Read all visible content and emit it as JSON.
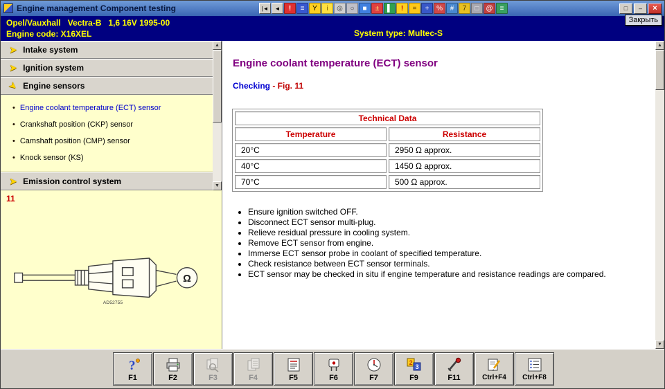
{
  "window": {
    "title": "Engine management Component testing",
    "close_label": "×",
    "close_tooltip": "Закрыть"
  },
  "top_toolbar": {
    "icons": [
      {
        "name": "nav-first-icon",
        "glyph": "|◄"
      },
      {
        "name": "nav-back-icon",
        "glyph": "◄"
      },
      {
        "name": "warning-icon",
        "glyph": "!"
      },
      {
        "name": "wiring-diagram-icon",
        "glyph": "≡"
      },
      {
        "name": "spark-plug-icon",
        "glyph": "Y"
      },
      {
        "name": "bulb-icon",
        "glyph": "i"
      },
      {
        "name": "cd-icon",
        "glyph": "◎"
      },
      {
        "name": "steering-wheel-icon",
        "glyph": "○"
      },
      {
        "name": "screen-icon",
        "glyph": "■"
      },
      {
        "name": "battery-icon",
        "glyph": "±"
      },
      {
        "name": "manual-icon",
        "glyph": "▌"
      },
      {
        "name": "lamp-icon",
        "glyph": "!"
      },
      {
        "name": "fuse-icon",
        "glyph": "="
      },
      {
        "name": "tools-icon",
        "glyph": "+"
      },
      {
        "name": "meter-icon",
        "glyph": "%"
      },
      {
        "name": "chip-icon",
        "glyph": "#"
      },
      {
        "name": "wrench-icon",
        "glyph": "7"
      },
      {
        "name": "monitor-icon",
        "glyph": "□"
      },
      {
        "name": "gauge-icon",
        "glyph": "@"
      },
      {
        "name": "service-list-icon",
        "glyph": "≡"
      }
    ],
    "window_buttons": [
      {
        "name": "window-restore-button",
        "glyph": "□"
      },
      {
        "name": "window-minimize-button",
        "glyph": "–"
      }
    ]
  },
  "header": {
    "vehicle_line": "Opel/Vauxhall   Vectra-B   1,6 16V 1995-00",
    "engine_code_line": "Engine code: X16XEL",
    "system_type": "System type: Multec-S"
  },
  "sidebar": {
    "arrow_glyph": "➤",
    "sections": [
      {
        "label": "Intake system"
      },
      {
        "label": "Ignition system"
      },
      {
        "label": "Engine sensors"
      },
      {
        "label": "Emission control system"
      }
    ],
    "engine_sensor_items": [
      {
        "label": "Engine coolant temperature (ECT) sensor",
        "selected": true
      },
      {
        "label": "Crankshaft position (CKP) sensor",
        "selected": false
      },
      {
        "label": "Camshaft position (CMP) sensor",
        "selected": false
      },
      {
        "label": "Knock sensor (KS)",
        "selected": false
      }
    ],
    "bullet_glyph": "•"
  },
  "figure": {
    "number": "11",
    "code": "AD52755",
    "ohm_symbol": "Ω"
  },
  "content": {
    "title": "Engine coolant temperature (ECT) sensor",
    "checking_label": "Checking",
    "checking_fig": " - Fig. 11",
    "table": {
      "header": "Technical Data",
      "columns": [
        "Temperature",
        "Resistance"
      ],
      "rows": [
        [
          "20°C",
          "2950 Ω approx."
        ],
        [
          "40°C",
          "1450 Ω approx."
        ],
        [
          "70°C",
          "500 Ω approx."
        ]
      ]
    },
    "bullets": [
      "Ensure ignition switched OFF.",
      "Disconnect ECT sensor multi-plug.",
      "Relieve residual pressure in cooling system.",
      "Remove ECT sensor from engine.",
      "Immerse ECT sensor probe in coolant of specified temperature.",
      "Check resistance between ECT sensor terminals.",
      "ECT sensor may be checked in situ if engine temperature and resistance readings are compared."
    ]
  },
  "bottom_toolbar": {
    "buttons": [
      {
        "label": "F1",
        "icon": "help-icon",
        "enabled": true
      },
      {
        "label": "F2",
        "icon": "printer-icon",
        "enabled": true
      },
      {
        "label": "F3",
        "icon": "pages-search-icon",
        "enabled": false
      },
      {
        "label": "F4",
        "icon": "pages-icon",
        "enabled": false
      },
      {
        "label": "F5",
        "icon": "technical-data-icon",
        "enabled": true
      },
      {
        "label": "F6",
        "icon": "component-icon",
        "enabled": true
      },
      {
        "label": "F7",
        "icon": "dial-icon",
        "enabled": true
      },
      {
        "label": "F9",
        "icon": "numbers-icon",
        "enabled": true
      },
      {
        "label": "F11",
        "icon": "probe-icon",
        "enabled": true
      },
      {
        "label": "Ctrl+F4",
        "icon": "document-edit-icon",
        "enabled": true
      },
      {
        "label": "Ctrl+F8",
        "icon": "bullet-list-icon",
        "enabled": true
      }
    ]
  },
  "scrollbar": {
    "up_glyph": "▲",
    "down_glyph": "▼"
  }
}
